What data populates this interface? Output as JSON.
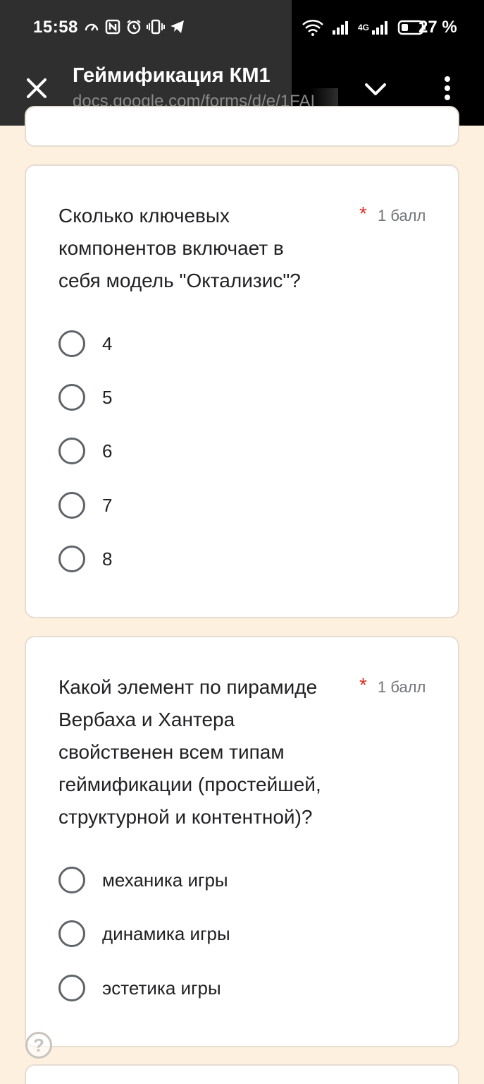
{
  "status_bar": {
    "time": "15:58",
    "network_label": "4G",
    "battery": "27 %"
  },
  "header": {
    "title": "Геймификация КМ1",
    "url": "docs.google.com/forms/d/e/1FAI"
  },
  "questions": [
    {
      "lines": [
        "Сколько ключевых",
        "компонентов включает в",
        "себя модель \"Октализис\"?"
      ],
      "required_mark": "*",
      "points": "1 балл",
      "options": [
        "4",
        "5",
        "6",
        "7",
        "8"
      ]
    },
    {
      "lines": [
        "Какой элемент по пирамиде",
        "Вербаха и Хантера",
        "свойственен всем типам",
        "геймификации (простейшей,",
        "структурной и контентной)?"
      ],
      "required_mark": "*",
      "points": "1 балл",
      "options": [
        "механика игры",
        "динамика игры",
        "эстетика игры"
      ]
    }
  ],
  "help": {
    "symbol": "?"
  },
  "icons": {
    "close": "close-icon",
    "expand": "chevron-down-icon",
    "menu": "more-vert-icon",
    "help": "help-icon"
  },
  "colors": {
    "background": "#fdf0de",
    "topbar": "#2f2f2f",
    "required": "#d93025",
    "radio": "#5f6368"
  }
}
